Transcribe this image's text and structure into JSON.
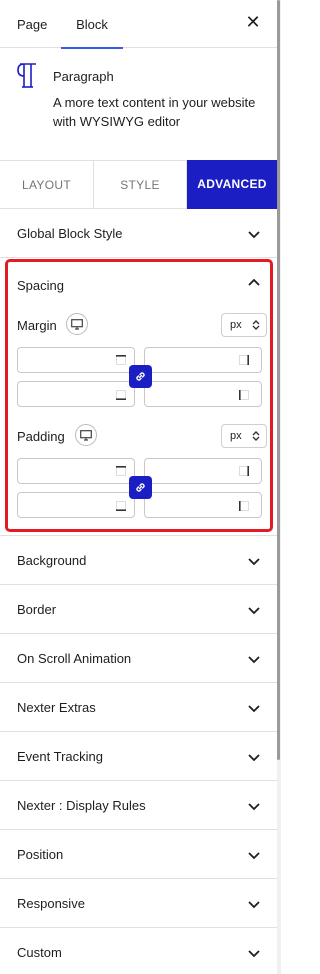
{
  "sidebar_tabs": {
    "page": "Page",
    "block": "Block"
  },
  "block_card": {
    "title": "Paragraph",
    "description": "A more text content in your website with WYSIWYG editor"
  },
  "mode_tabs": {
    "layout": "LAYOUT",
    "style": "STYLE",
    "advanced": "ADVANCED"
  },
  "panels": {
    "global_block_style": "Global Block Style",
    "spacing": "Spacing",
    "background": "Background",
    "border": "Border",
    "on_scroll_animation": "On Scroll Animation",
    "nexter_extras": "Nexter Extras",
    "event_tracking": "Event Tracking",
    "nexter_display_rules": "Nexter : Display Rules",
    "position": "Position",
    "responsive": "Responsive",
    "custom": "Custom"
  },
  "spacing": {
    "margin": {
      "label": "Margin",
      "unit": "px",
      "top": "",
      "right": "",
      "bottom": "",
      "left": ""
    },
    "padding": {
      "label": "Padding",
      "unit": "px",
      "top": "",
      "right": "",
      "bottom": "",
      "left": ""
    }
  },
  "colors": {
    "accent": "#1b1fc3",
    "highlight_border": "#e31b23",
    "tab_underline": "#3858e9"
  }
}
